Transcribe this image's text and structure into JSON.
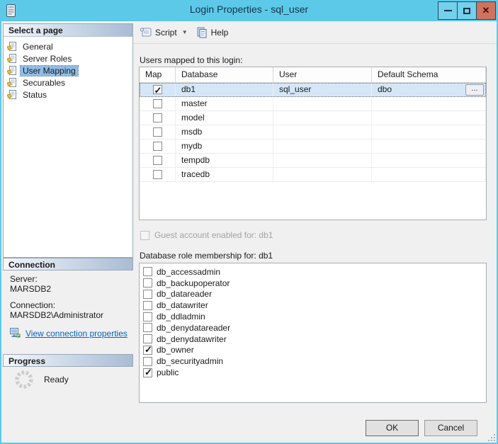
{
  "window": {
    "title": "Login Properties - sql_user"
  },
  "icons": {
    "minimize": "–",
    "maximize": "❐",
    "close": "✕",
    "dropdown": "▼",
    "checkmark": "✓",
    "ellipsis": "..."
  },
  "colors": {
    "titlebar": "#5dc9e8",
    "close_button": "#cf7260",
    "selection": "#8fbce6",
    "selected_row": "#d5e7f7",
    "link": "#0563c1"
  },
  "sidebar": {
    "select_page_header": "Select a page",
    "pages": [
      {
        "label": "General",
        "selected": false
      },
      {
        "label": "Server Roles",
        "selected": false
      },
      {
        "label": "User Mapping",
        "selected": true
      },
      {
        "label": "Securables",
        "selected": false
      },
      {
        "label": "Status",
        "selected": false
      }
    ],
    "connection_header": "Connection",
    "server_label": "Server:",
    "server_value": "MARSDB2",
    "connection_label": "Connection:",
    "connection_value": "MARSDB2\\Administrator",
    "view_connection_link": "View connection properties",
    "progress_header": "Progress",
    "progress_status": "Ready"
  },
  "toolbar": {
    "script_label": "Script",
    "help_label": "Help"
  },
  "main": {
    "users_mapped_label": "Users mapped to this login:",
    "table": {
      "columns": [
        "Map",
        "Database",
        "User",
        "Default Schema"
      ],
      "rows": [
        {
          "map": true,
          "database": "db1",
          "user": "sql_user",
          "default_schema": "dbo",
          "selected": true
        },
        {
          "map": false,
          "database": "master",
          "user": "",
          "default_schema": "",
          "selected": false
        },
        {
          "map": false,
          "database": "model",
          "user": "",
          "default_schema": "",
          "selected": false
        },
        {
          "map": false,
          "database": "msdb",
          "user": "",
          "default_schema": "",
          "selected": false
        },
        {
          "map": false,
          "database": "mydb",
          "user": "",
          "default_schema": "",
          "selected": false
        },
        {
          "map": false,
          "database": "tempdb",
          "user": "",
          "default_schema": "",
          "selected": false
        },
        {
          "map": false,
          "database": "tracedb",
          "user": "",
          "default_schema": "",
          "selected": false
        }
      ]
    },
    "guest_checkbox_label": "Guest account enabled for: db1",
    "role_membership_label": "Database role membership for: db1",
    "roles": [
      {
        "name": "db_accessadmin",
        "checked": false
      },
      {
        "name": "db_backupoperator",
        "checked": false
      },
      {
        "name": "db_datareader",
        "checked": false
      },
      {
        "name": "db_datawriter",
        "checked": false
      },
      {
        "name": "db_ddladmin",
        "checked": false
      },
      {
        "name": "db_denydatareader",
        "checked": false
      },
      {
        "name": "db_denydatawriter",
        "checked": false
      },
      {
        "name": "db_owner",
        "checked": true
      },
      {
        "name": "db_securityadmin",
        "checked": false
      },
      {
        "name": "public",
        "checked": true
      }
    ],
    "ok_label": "OK",
    "cancel_label": "Cancel"
  }
}
